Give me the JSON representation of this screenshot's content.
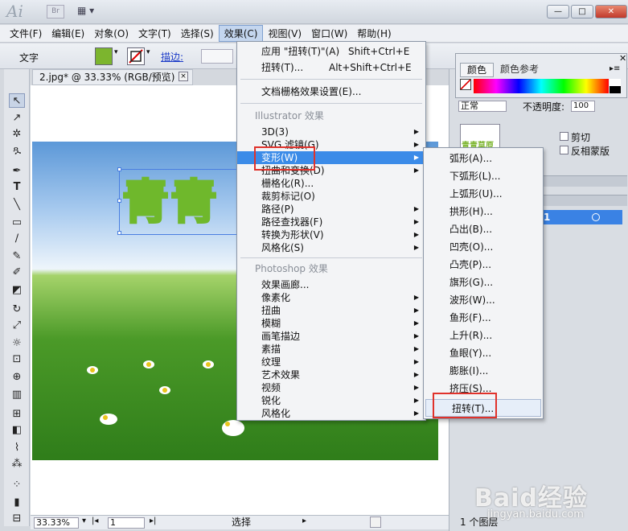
{
  "titlebar": {
    "app_logo": "Ai",
    "bridge": "Br",
    "layout_icon": "layout-grid-icon",
    "window_buttons": [
      "—",
      "□",
      "✕"
    ]
  },
  "menubar": [
    "文件(F)",
    "编辑(E)",
    "对象(O)",
    "文字(T)",
    "选择(S)",
    "效果(C)",
    "视图(V)",
    "窗口(W)",
    "帮助(H)"
  ],
  "active_menu": "效果(C)",
  "control_bar": {
    "tool_label": "文字",
    "fill_color": "#7cb52e",
    "stroke_label": "描边:"
  },
  "document": {
    "tab": "2.jpg* @ 33.33% (RGB/预览)",
    "close": "×",
    "art_text": "青青",
    "zoom": "33.33%",
    "page": "1",
    "status": "选择"
  },
  "effect_menu": {
    "apply_last": {
      "label": "应用 \"扭转(T)\"(A)",
      "shortcut": "Shift+Ctrl+E"
    },
    "last_effect": {
      "label": "扭转(T)...",
      "shortcut": "Alt+Shift+Ctrl+E"
    },
    "raster_settings": "文档栅格效果设置(E)...",
    "illustrator_header": "Illustrator 效果",
    "illustrator_items": [
      "3D(3)",
      "SVG 滤镜(G)",
      "变形(W)",
      "扭曲和变换(D)",
      "栅格化(R)...",
      "裁剪标记(O)",
      "路径(P)",
      "路径查找器(F)",
      "转换为形状(V)",
      "风格化(S)"
    ],
    "photoshop_header": "Photoshop 效果",
    "photoshop_items": [
      "效果画廊...",
      "像素化",
      "扭曲",
      "模糊",
      "画笔描边",
      "素描",
      "纹理",
      "艺术效果",
      "视频",
      "锐化",
      "风格化"
    ]
  },
  "warp_menu": [
    "弧形(A)...",
    "下弧形(L)...",
    "上弧形(U)...",
    "拱形(H)...",
    "凸出(B)...",
    "凹壳(O)...",
    "凸壳(P)...",
    "旗形(G)...",
    "波形(W)...",
    "鱼形(F)...",
    "上升(R)...",
    "鱼眼(Y)...",
    "膨胀(I)...",
    "挤压(S)...",
    "扭转(T)..."
  ],
  "color_panel": {
    "tab_color": "颜色",
    "tab_color_ref": "颜色参考"
  },
  "transparency_panel": {
    "mode": "正常",
    "opacity_label": "不透明度:",
    "opacity_value": "100",
    "thumb_text": "青青草原",
    "clip": "剪切",
    "invert": "反相蒙版"
  },
  "layers_panel": {
    "layer_number": "1",
    "footer": "1 个图层"
  },
  "watermark": {
    "brand": "Baid经验",
    "url": "jingyan.baidu.com"
  }
}
